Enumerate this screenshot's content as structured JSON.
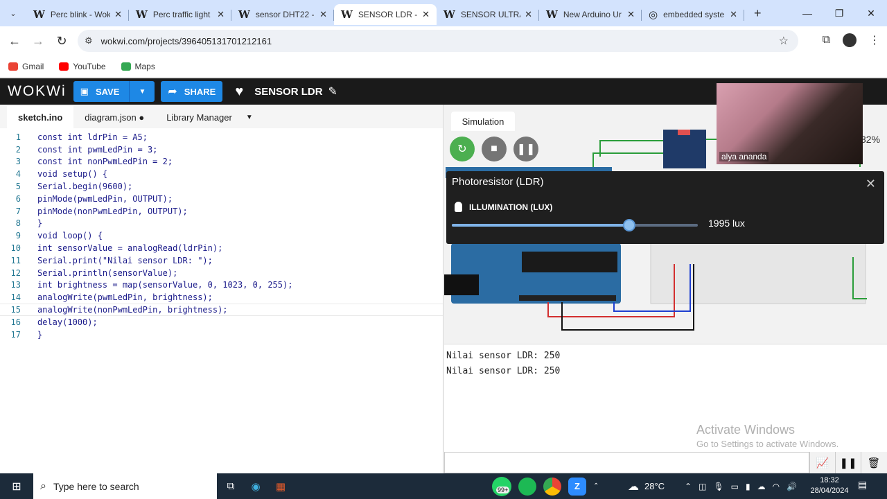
{
  "browser": {
    "tabs": [
      {
        "title": "Perc blink - Wok",
        "active": false
      },
      {
        "title": "Perc traffic light",
        "active": false
      },
      {
        "title": "sensor DHT22 -",
        "active": false
      },
      {
        "title": "SENSOR LDR - V",
        "active": true
      },
      {
        "title": "SENSOR ULTRA",
        "active": false
      },
      {
        "title": "New Arduino Ur",
        "active": false
      },
      {
        "title": "embedded syste",
        "active": false
      }
    ],
    "url": "wokwi.com/projects/396405131701212161",
    "bookmarks": [
      "Gmail",
      "YouTube",
      "Maps"
    ]
  },
  "wokwi": {
    "logo": "WOKWi",
    "save_label": "SAVE",
    "share_label": "SHARE",
    "project_name": "SENSOR LDR"
  },
  "editor": {
    "tabs": [
      "sketch.ino",
      "diagram.json ●",
      "Library Manager"
    ],
    "lines": [
      "const int ldrPin = A5;",
      "const int pwmLedPin = 3;",
      "const int nonPwmLedPin = 2;",
      "void setup() {",
      "Serial.begin(9600);",
      "pinMode(pwmLedPin, OUTPUT);",
      "pinMode(nonPwmLedPin, OUTPUT);",
      "}",
      "void loop() {",
      "int sensorValue = analogRead(ldrPin);",
      "Serial.print(\"Nilai sensor LDR: \");",
      "Serial.println(sensorValue);",
      "int brightness = map(sensorValue, 0, 1023, 0, 255);",
      "analogWrite(pwmLedPin, brightness);",
      "analogWrite(nonPwmLedPin, brightness);",
      "delay(1000);",
      "}"
    ],
    "highlighted_line": 15
  },
  "simulation": {
    "tab_label": "Simulation",
    "zoom": "32%",
    "popup": {
      "title": "Photoresistor (LDR)",
      "label": "ILLUMINATION (LUX)",
      "value_text": "1995 lux",
      "slider_fraction": 0.72
    },
    "serial_output": [
      "Nilai sensor LDR: 250",
      "Nilai sensor LDR: 250"
    ]
  },
  "webcam": {
    "name": "alya ananda"
  },
  "watermark": {
    "line1": "Activate Windows",
    "line2": "Go to Settings to activate Windows."
  },
  "taskbar": {
    "search_placeholder": "Type here to search",
    "weather": "28°C",
    "time": "18:32",
    "date": "28/04/2024",
    "badge": "99+"
  }
}
